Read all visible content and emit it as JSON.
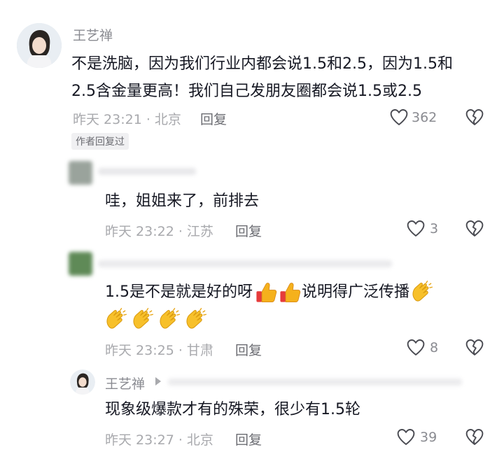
{
  "comments": [
    {
      "author": "王艺禅",
      "text_line1": "不是洗脑，因为我们行业内都会说1.5和2.5，因为1.5和",
      "text_line2": "2.5含金量更高！我们自己发朋友圈都会说1.5或2.5",
      "time": "昨天 23:21 · 北京",
      "reply_label": "回复",
      "likes": "362",
      "author_badge": "作者回复过"
    },
    {
      "text": "哇，姐姐来了，前排去",
      "time": "昨天 23:22 · 江苏",
      "reply_label": "回复",
      "likes": "3"
    },
    {
      "text_line1": "1.5是不是就是好的呀",
      "text_line1b": "说明得广泛传播",
      "time": "昨天 23:25 · 甘肃",
      "reply_label": "回复",
      "likes": "8"
    },
    {
      "author": "王艺禅",
      "text": "现象级爆款才有的殊荣，很少有1.5轮",
      "time": "昨天 23:27 · 北京",
      "reply_label": "回复",
      "likes": "39"
    }
  ],
  "colors": {
    "heart": "#8a8b91",
    "thumb": "#f2a120",
    "clap": "#f5b921"
  },
  "icons": [
    "heart-icon",
    "broken-heart-icon",
    "thumbs-up-icon",
    "clapping-hands-icon",
    "reply-arrow-icon"
  ]
}
